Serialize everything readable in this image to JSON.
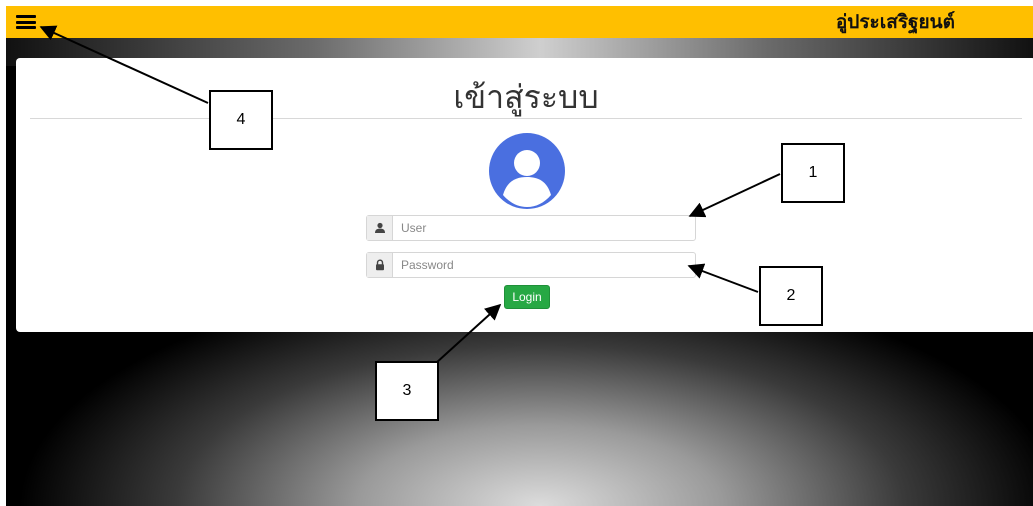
{
  "header": {
    "menu_icon": "hamburger-menu-icon",
    "brand": "อู่ประเสริฐยนต์",
    "background_color": "#ffbf00"
  },
  "login": {
    "title": "เข้าสู่ระบบ",
    "avatar_icon": "user-avatar-icon",
    "avatar_color": "#4a6fe0",
    "username": {
      "icon": "user-icon",
      "placeholder": "User",
      "value": ""
    },
    "password": {
      "icon": "lock-icon",
      "placeholder": "Password",
      "value": ""
    },
    "login_label": "Login",
    "login_color": "#27a844"
  },
  "callouts": [
    "1",
    "2",
    "3",
    "4"
  ]
}
